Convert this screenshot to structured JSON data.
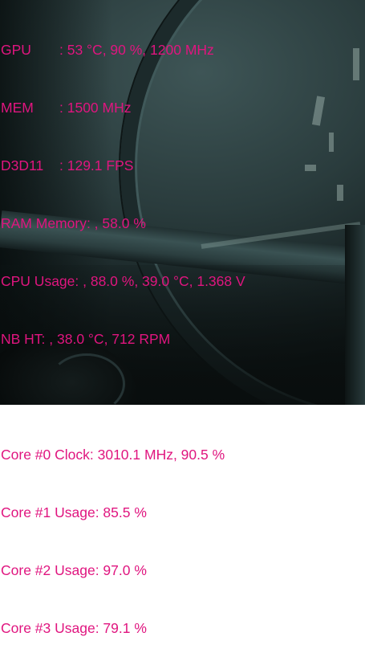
{
  "osd": {
    "color": "#e0157f",
    "gpu": {
      "label": "GPU",
      "value": ": 53 °C, 90 %, 1200 MHz"
    },
    "mem": {
      "label": "MEM",
      "value": ": 1500 MHz"
    },
    "d3d11": {
      "label": "D3D11",
      "value": ": 129.1 FPS"
    },
    "ram": {
      "text": "RAM Memory: , 58.0 %"
    },
    "cpu": {
      "text": "CPU Usage: , 88.0 %, 39.0 °C, 1.368 V"
    },
    "nb": {
      "text": "NB HT: , 38.0 °C, 712 RPM"
    },
    "cores": [
      {
        "text": "Core #0 Clock: 3010.1 MHz, 90.5 %"
      },
      {
        "text": "Core #1 Usage: 85.5 %"
      },
      {
        "text": "Core #2 Usage: 97.0 %"
      },
      {
        "text": "Core #3 Usage: 79.1 %"
      }
    ]
  }
}
